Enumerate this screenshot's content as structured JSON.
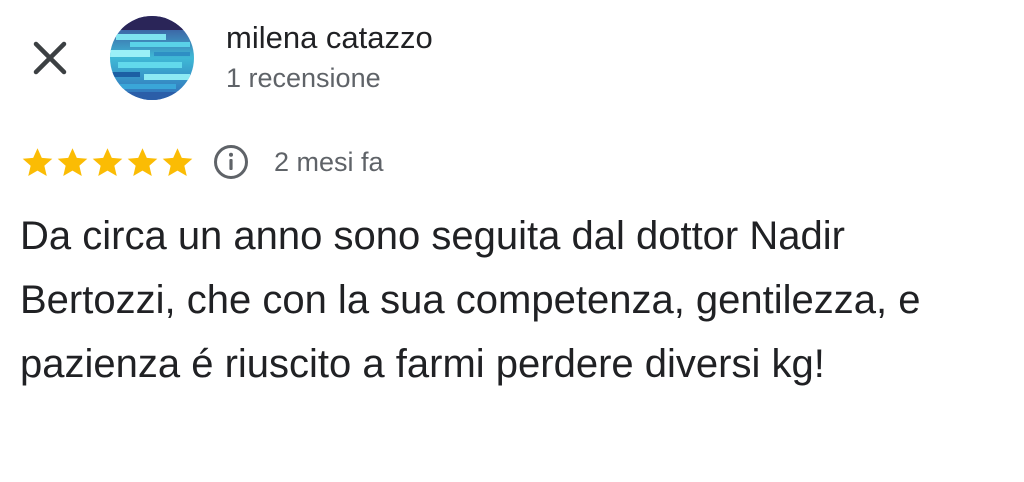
{
  "header": {
    "close_icon": "close-icon",
    "reviewer": {
      "name": "milena catazzo",
      "review_count": "1 recensione",
      "avatar_icon": "avatar-image"
    }
  },
  "review": {
    "rating": 5,
    "rating_max": 5,
    "star_color": "#FBBC04",
    "info_icon": "info-icon",
    "date": "2 mesi fa",
    "text": "Da circa un anno sono seguita dal dottor Nadir Bertozzi, che con la sua competenza, gentilezza, e pazienza é riuscito a farmi perdere diversi kg!"
  }
}
